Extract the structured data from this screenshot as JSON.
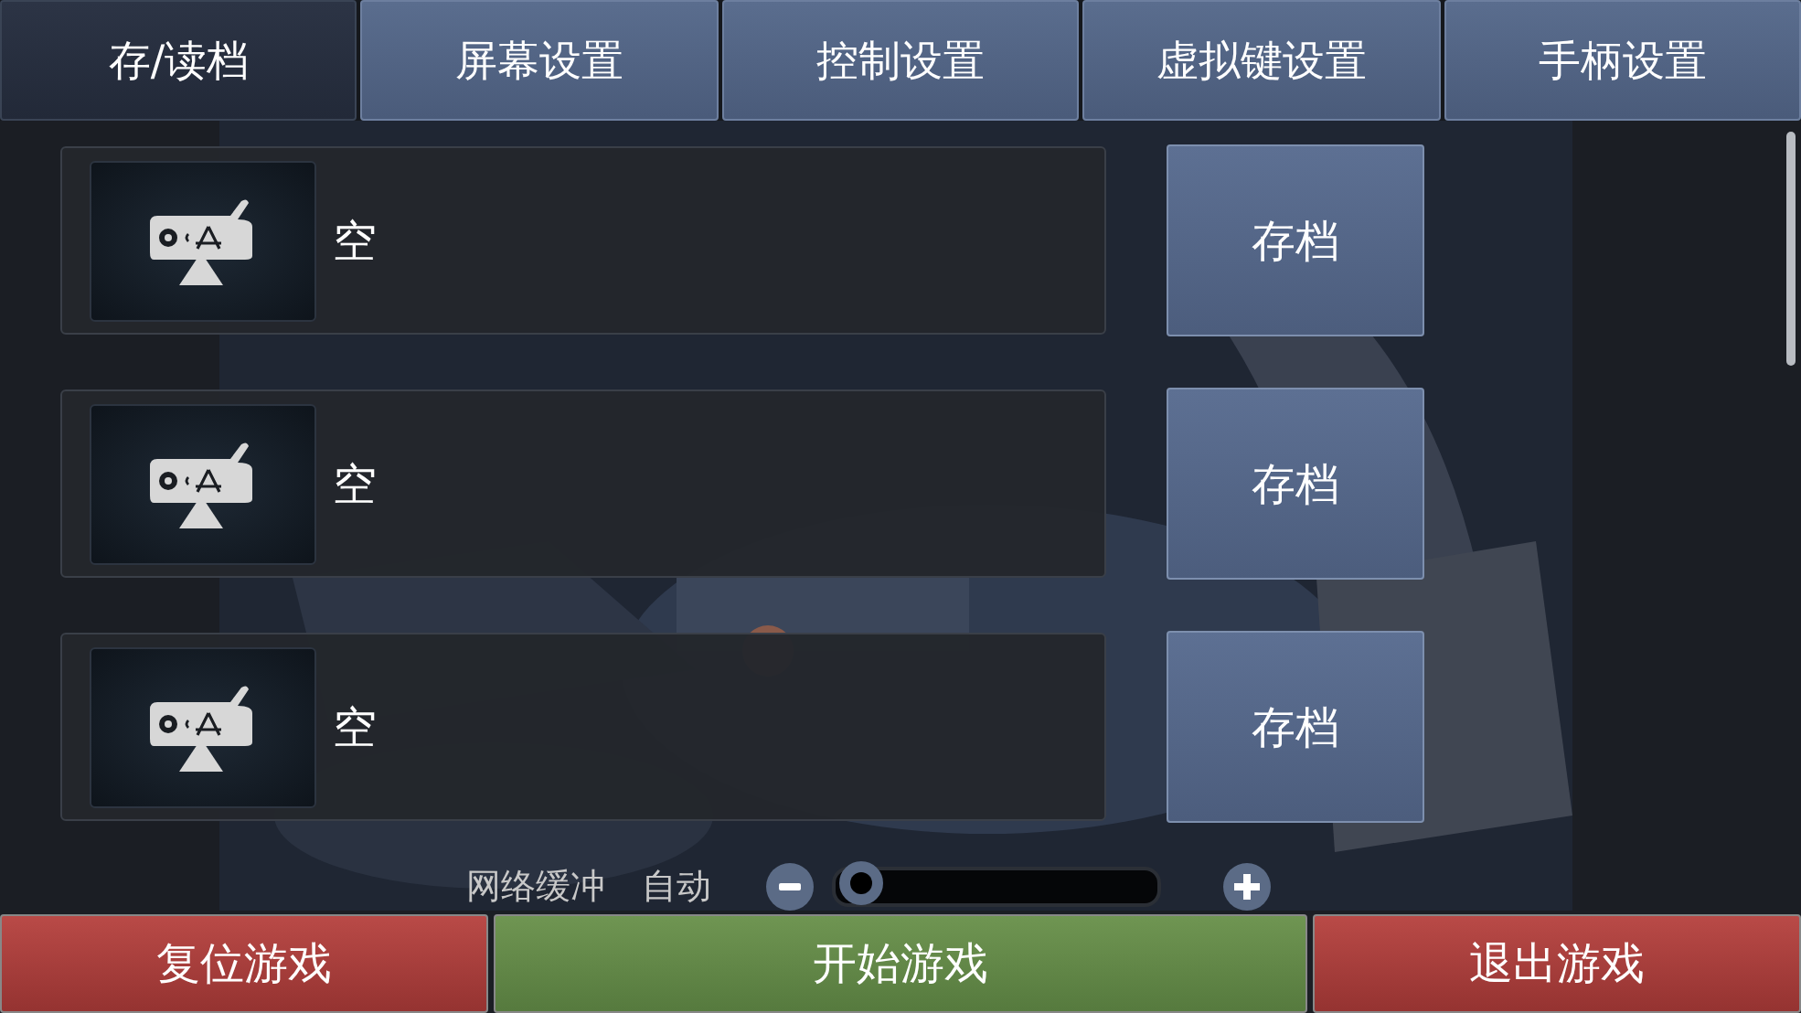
{
  "tabs": [
    {
      "label": "存/读档",
      "selected": true
    },
    {
      "label": "屏幕设置",
      "selected": false
    },
    {
      "label": "控制设置",
      "selected": false
    },
    {
      "label": "虚拟键设置",
      "selected": false
    },
    {
      "label": "手柄设置",
      "selected": false
    }
  ],
  "slots": [
    {
      "name": "空",
      "button": "存档"
    },
    {
      "name": "空",
      "button": "存档"
    },
    {
      "name": "空",
      "button": "存档"
    }
  ],
  "network_buffer": {
    "label": "网络缓冲",
    "value": "自动",
    "level": 0.02
  },
  "actions": [
    {
      "label": "复位游戏",
      "kind": "danger"
    },
    {
      "label": "开始游戏",
      "kind": "primary"
    },
    {
      "label": "退出游戏",
      "kind": "danger"
    }
  ]
}
